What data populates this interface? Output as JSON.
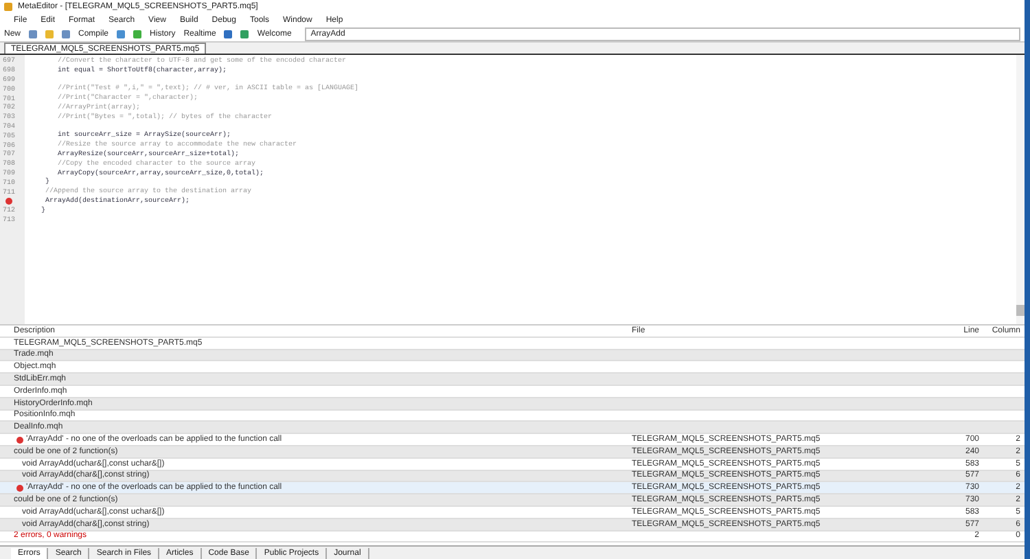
{
  "window": {
    "title": "MetaEditor - [TELEGRAM_MQL5_SCREENSHOTS_PART5.mq5]"
  },
  "menu": [
    "File",
    "Edit",
    "Format",
    "Search",
    "View",
    "Build",
    "Debug",
    "Tools",
    "Window",
    "Help"
  ],
  "toolbar": {
    "new": "New",
    "compile": "Compile",
    "history": "History",
    "realtime": "Realtime",
    "welcome": "Welcome",
    "search_value": "ArrayAdd"
  },
  "tabs": [
    {
      "label": "TELEGRAM_MQL5_SCREENSHOTS_PART5.mq5",
      "selected": true
    }
  ],
  "code_lines": [
    {
      "number": "697",
      "text": "      //Convert the character to UTF-8 and get some of the encoded character",
      "kind": "comment"
    },
    {
      "number": "698",
      "text": "      int equal = ShortToUtf8(character,array);",
      "kind": "code"
    },
    {
      "number": "699",
      "kind": "code"
    },
    {
      "number": "700",
      "text": "      //Print(\"Test # \",i,\" = \",text); // # ver, in ASCII table = as [LANGUAGE]",
      "kind": "comment"
    },
    {
      "number": "701",
      "text": "      //Print(\"Character = \",character);",
      "kind": "comment"
    },
    {
      "number": "702",
      "text": "      //ArrayPrint(array);",
      "kind": "comment"
    },
    {
      "number": "703",
      "text": "      //Print(\"Bytes = \",total); // bytes of the character",
      "kind": "comment"
    },
    {
      "number": "704",
      "kind": "code"
    },
    {
      "number": "705",
      "text": "      int sourceArr_size = ArraySize(sourceArr);",
      "kind": "code"
    },
    {
      "number": "706",
      "text": "      //Resize the source array to accommodate the new character",
      "kind": "comment"
    },
    {
      "number": "707",
      "text": "      ArrayResize(sourceArr,sourceArr_size+total);",
      "kind": "code"
    },
    {
      "number": "708",
      "text": "      //Copy the encoded character to the source array",
      "kind": "comment"
    },
    {
      "number": "709",
      "text": "      ArrayCopy(sourceArr,array,sourceArr_size,0,total);",
      "kind": "code"
    },
    {
      "number": "710",
      "text": "   }",
      "kind": "code"
    },
    {
      "number": "711",
      "text": "   //Append the source array to the destination array",
      "kind": "comment"
    },
    {
      "text": "   ArrayAdd(destinationArr,sourceArr);",
      "kind": "error"
    },
    {
      "number": "712",
      "text": "  }",
      "kind": "code"
    },
    {
      "number": "713",
      "kind": "code"
    }
  ],
  "errors": {
    "columns": [
      "Description",
      "File",
      "Line",
      "Column"
    ],
    "rows": [
      {
        "kind": "file",
        "description": "TELEGRAM_MQL5_SCREENSHOTS_PART5.mq5",
        "selected": false
      },
      {
        "kind": "file",
        "description": "Trade.mqh",
        "selected": false
      },
      {
        "kind": "file",
        "description": "Object.mqh",
        "selected": false
      },
      {
        "kind": "file",
        "description": "StdLibErr.mqh",
        "selected": false
      },
      {
        "kind": "file",
        "description": "OrderInfo.mqh",
        "selected": false
      },
      {
        "kind": "file",
        "description": "HistoryOrderInfo.mqh",
        "selected": false
      },
      {
        "kind": "file",
        "description": "PositionInfo.mqh",
        "selected": false
      },
      {
        "kind": "file",
        "description": "DealInfo.mqh",
        "selected": false
      },
      {
        "kind": "error",
        "description": "'ArrayAdd' - no one of the overloads can be applied to the function call",
        "file": "TELEGRAM_MQL5_SCREENSHOTS_PART5.mq5",
        "line": "700",
        "column": "2",
        "selected": false
      },
      {
        "kind": "info",
        "description": "could be one of 2 function(s)",
        "file": "TELEGRAM_MQL5_SCREENSHOTS_PART5.mq5",
        "line": "240",
        "column": "2",
        "selected": false
      },
      {
        "kind": "detail",
        "description": "void ArrayAdd(uchar&[],const uchar&[])",
        "file": "TELEGRAM_MQL5_SCREENSHOTS_PART5.mq5",
        "line": "583",
        "column": "5",
        "selected": false
      },
      {
        "kind": "detail",
        "description": "void ArrayAdd(char&[],const string)",
        "file": "TELEGRAM_MQL5_SCREENSHOTS_PART5.mq5",
        "line": "577",
        "column": "6",
        "selected": false
      },
      {
        "kind": "error",
        "description": "'ArrayAdd' - no one of the overloads can be applied to the function call",
        "file": "TELEGRAM_MQL5_SCREENSHOTS_PART5.mq5",
        "line": "730",
        "column": "2",
        "selected": true
      },
      {
        "kind": "info",
        "description": "could be one of 2 function(s)",
        "file": "TELEGRAM_MQL5_SCREENSHOTS_PART5.mq5",
        "line": "730",
        "column": "2",
        "selected": false
      },
      {
        "kind": "detail",
        "description": "void ArrayAdd(uchar&[],const uchar&[])",
        "file": "TELEGRAM_MQL5_SCREENSHOTS_PART5.mq5",
        "line": "583",
        "column": "5",
        "selected": false
      },
      {
        "kind": "detail",
        "description": "void ArrayAdd(char&[],const string)",
        "file": "TELEGRAM_MQL5_SCREENSHOTS_PART5.mq5",
        "line": "577",
        "column": "6",
        "selected": false
      },
      {
        "kind": "summary",
        "description": "2 errors, 0 warnings",
        "line": "2",
        "column": "0",
        "selected": false
      }
    ]
  },
  "bottom_tabs": [
    {
      "label": "Errors",
      "selected": true
    },
    {
      "label": "Search",
      "selected": false
    },
    {
      "label": "Search in Files",
      "selected": false
    },
    {
      "label": "Articles",
      "selected": false
    },
    {
      "label": "Code Base",
      "selected": false
    },
    {
      "label": "Public Projects",
      "selected": false
    },
    {
      "label": "Journal",
      "selected": false
    }
  ]
}
